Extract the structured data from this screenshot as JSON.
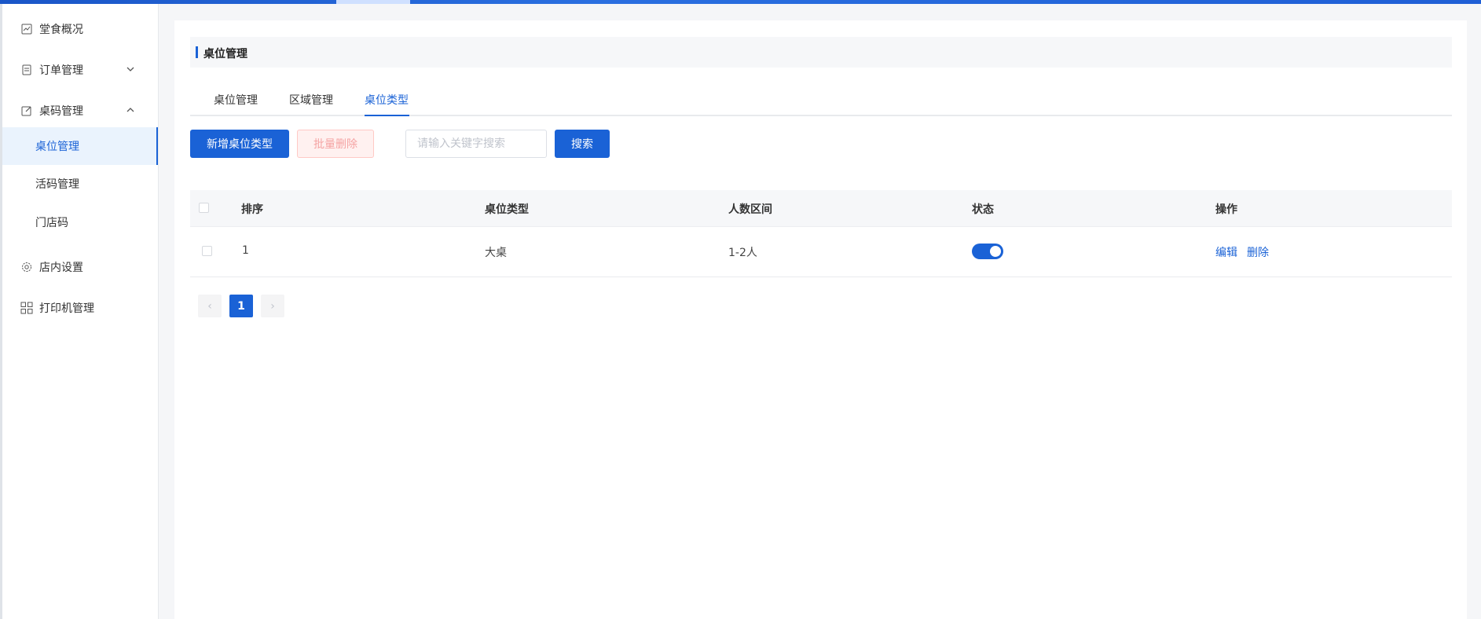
{
  "sidebar": {
    "items": [
      {
        "label": "堂食概况",
        "icon": "chart-line-icon"
      },
      {
        "label": "订单管理",
        "icon": "document-icon",
        "expanded": false
      },
      {
        "label": "桌码管理",
        "icon": "edit-square-icon",
        "expanded": true
      },
      {
        "label": "店内设置",
        "icon": "gear-icon"
      },
      {
        "label": "打印机管理",
        "icon": "grid-icon"
      }
    ],
    "sub_items": [
      {
        "label": "桌位管理",
        "active": true
      },
      {
        "label": "活码管理",
        "active": false
      },
      {
        "label": "门店码",
        "active": false
      }
    ]
  },
  "page": {
    "title": "桌位管理",
    "tabs": [
      {
        "label": "桌位管理",
        "active": false
      },
      {
        "label": "区域管理",
        "active": false
      },
      {
        "label": "桌位类型",
        "active": true
      }
    ]
  },
  "toolbar": {
    "add_label": "新增桌位类型",
    "batch_delete_label": "批量删除",
    "search_placeholder": "请输入关键字搜索",
    "search_label": "搜索"
  },
  "table": {
    "columns": [
      "排序",
      "桌位类型",
      "人数区间",
      "状态",
      "操作"
    ],
    "rows": [
      {
        "order": "1",
        "type": "大桌",
        "range": "1-2人",
        "enabled": true,
        "edit": "编辑",
        "delete": "删除"
      }
    ]
  },
  "pagination": {
    "current": "1",
    "prev": "‹",
    "next": "›"
  },
  "colors": {
    "accent": "#1a62d6",
    "danger_text": "#f5a3a3"
  }
}
